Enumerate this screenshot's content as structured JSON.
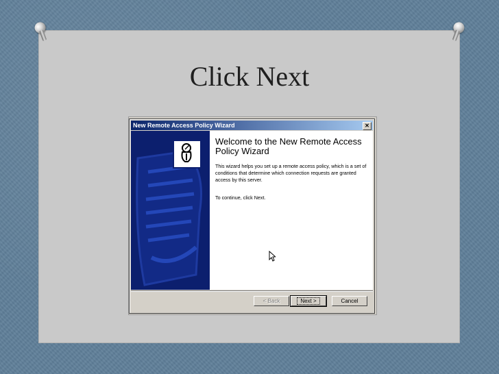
{
  "slide": {
    "title": "Click Next"
  },
  "wizard": {
    "window_title": "New Remote Access Policy Wizard",
    "close_glyph": "✕",
    "heading": "Welcome to the New Remote Access Policy Wizard",
    "description": "This wizard helps you set up a remote access policy, which is a set of conditions that determine which connection requests are granted access by this server.",
    "instruction": "To continue, click Next.",
    "buttons": {
      "back": "< Back",
      "next": "Next >",
      "cancel": "Cancel"
    },
    "icons": {
      "logo": "policy-wizard-icon",
      "cursor": "mouse-pointer"
    }
  },
  "colors": {
    "panel_blue": "#0c1f6e",
    "title_gradient_start": "#0a246a",
    "title_gradient_end": "#a6caf0",
    "dialog_gray": "#d4d0c8"
  }
}
